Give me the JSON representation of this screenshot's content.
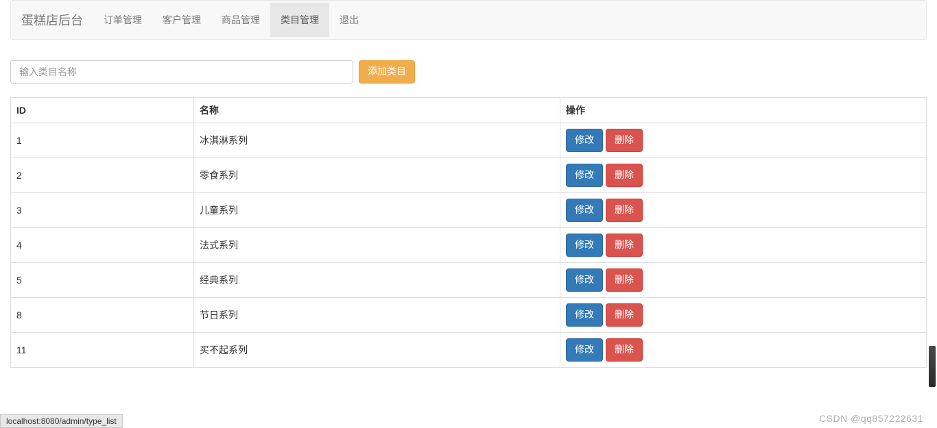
{
  "navbar": {
    "brand": "蛋糕店后台",
    "items": [
      {
        "label": "订单管理",
        "active": false
      },
      {
        "label": "客户管理",
        "active": false
      },
      {
        "label": "商品管理",
        "active": false
      },
      {
        "label": "类目管理",
        "active": true
      },
      {
        "label": "退出",
        "active": false
      }
    ]
  },
  "form": {
    "category_placeholder": "输入类目名称",
    "add_button": "添加类目"
  },
  "table": {
    "headers": {
      "id": "ID",
      "name": "名称",
      "op": "操作"
    },
    "edit_label": "修改",
    "delete_label": "删除",
    "rows": [
      {
        "id": "1",
        "name": "冰淇淋系列"
      },
      {
        "id": "2",
        "name": "零食系列"
      },
      {
        "id": "3",
        "name": "儿童系列"
      },
      {
        "id": "4",
        "name": "法式系列"
      },
      {
        "id": "5",
        "name": "经典系列"
      },
      {
        "id": "8",
        "name": "节日系列"
      },
      {
        "id": "11",
        "name": "买不起系列"
      }
    ]
  },
  "status_bar": "localhost:8080/admin/type_list",
  "watermark": "CSDN @qq857222631"
}
